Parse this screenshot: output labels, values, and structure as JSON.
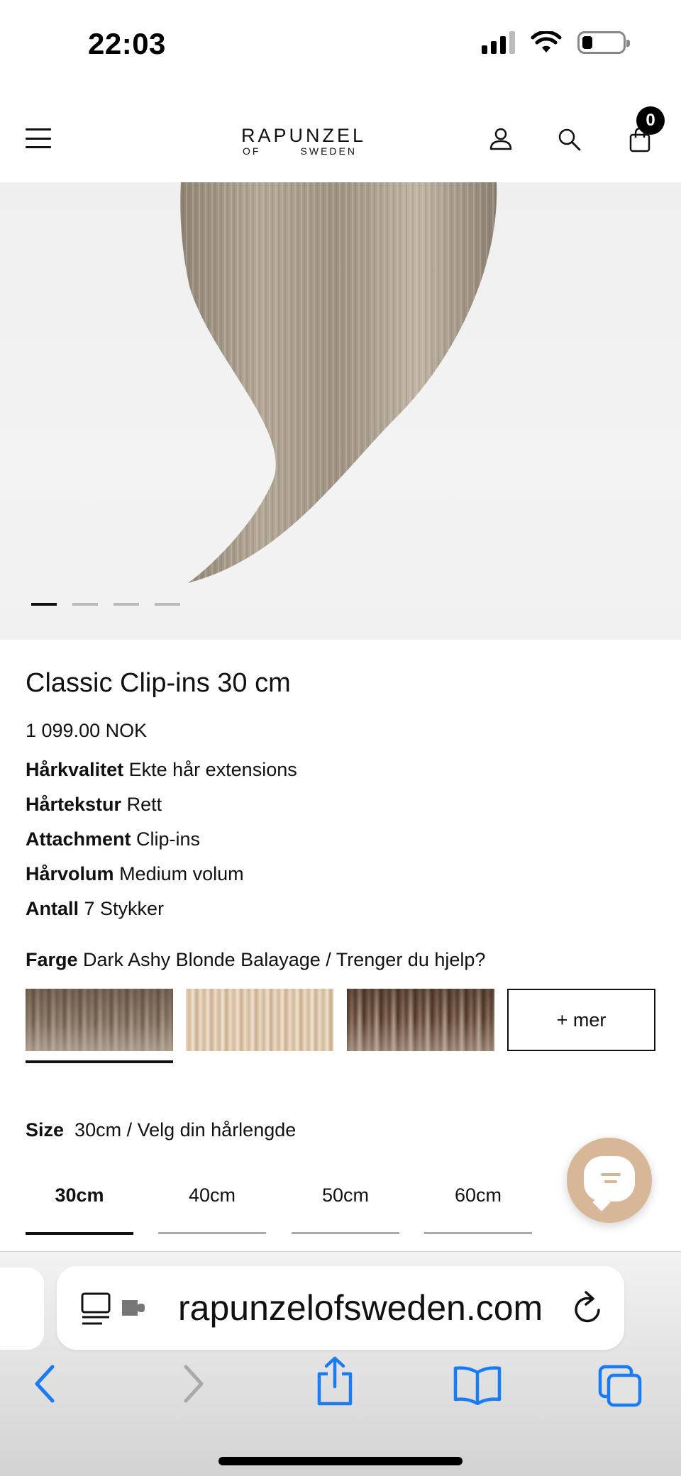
{
  "status_bar": {
    "time": "22:03"
  },
  "header": {
    "logo_top": "RAPUNZEL",
    "logo_bottom_left": "OF",
    "logo_bottom_right": "SWEDEN",
    "cart_count": "0",
    "icons": [
      "menu-icon",
      "user-icon",
      "search-icon",
      "cart-icon"
    ]
  },
  "carousel": {
    "total": 4,
    "active_index": 0
  },
  "product": {
    "title": "Classic Clip-ins 30 cm",
    "price": "1 099.00 NOK",
    "attributes": [
      {
        "label": "Hårkvalitet",
        "value": "Ekte hår extensions"
      },
      {
        "label": "Hårtekstur",
        "value": "Rett"
      },
      {
        "label": "Attachment",
        "value": "Clip-ins"
      },
      {
        "label": "Hårvolum",
        "value": "Medium volum"
      },
      {
        "label": "Antall",
        "value": "7 Stykker"
      }
    ],
    "color": {
      "label": "Farge",
      "value": "Dark Ashy Blonde Balayage / Trenger du hjelp?",
      "more_label": "+ mer",
      "selected_index": 0
    },
    "size": {
      "label": "Size",
      "value": "30cm / Velg din hårlengde",
      "options": [
        "30cm",
        "40cm",
        "50cm",
        "60cm"
      ],
      "selected_index": 0
    }
  },
  "browser": {
    "url": "rapunzelofsweden.com"
  },
  "colors": {
    "chat_button": "#d7b797",
    "link_blue": "#1a7cf5"
  }
}
